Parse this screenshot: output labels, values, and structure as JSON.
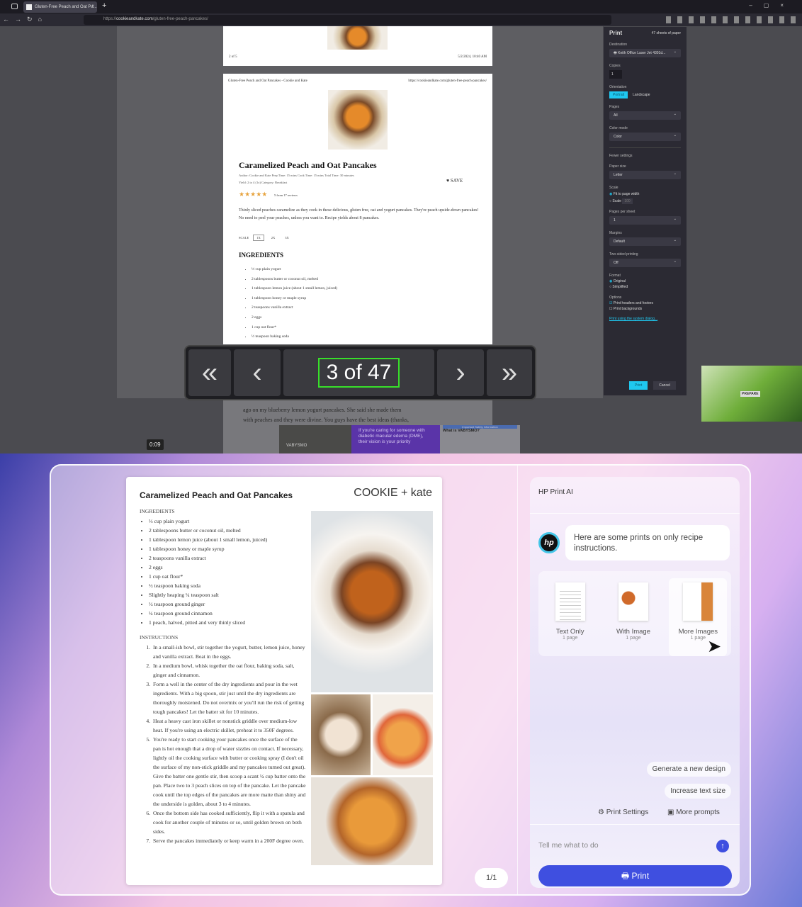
{
  "browser": {
    "tab_title": "Gluten-Free Peach and Oat Pa...",
    "url_scheme": "https://",
    "url_host": "cookieandkate.com",
    "url_path": "/gluten-free-peach-pancakes/"
  },
  "preview": {
    "page1_footer_left": "2 of 5",
    "page1_footer_right": "5/2/2024, 10:40 AM",
    "header_left": "Gluten-Free Peach and Oat Pancakes - Cookie and Kate",
    "header_right": "https://cookieandkate.com/gluten-free-peach-pancakes/",
    "title": "Caramelized Peach and Oat Pancakes",
    "meta1": "Author: Cookie and Kate   Prep Time: 15 mins   Cook Time: 15 mins   Total Time: 30 minutes",
    "meta2": "Yield: 2 to 4  (1x)   Category: Breakfast",
    "save": "SAVE",
    "stars": "★★★★★",
    "reviews": "5 from 17 reviews",
    "description": "Thinly sliced peaches caramelize as they cook in these delicious, gluten free, oat and yogurt pancakes. They're peach upside-down pancakes! No need to peel your peaches, unless you want to. Recipe yields about 8 pancakes.",
    "scale_label": "SCALE",
    "scale_options": [
      "1X",
      "2X",
      "3X"
    ],
    "ingredients_heading": "INGREDIENTS",
    "ingredients": [
      "⅓ cup plain yogurt",
      "2 tablespoons butter or coconut oil, melted",
      "1 tablespoon lemon juice (about 1 small lemon, juiced)",
      "1 tablespoon honey or maple syrup",
      "2 teaspoons vanilla extract",
      "2 eggs",
      "1 cup oat flour*",
      "½ teaspoon baking soda"
    ],
    "below_text": [
      "ago on my blueberry lemon yogurt pancakes. She said she made them",
      "with peaches and they were divine. You guys have the best ideas (thanks,"
    ],
    "ad_text": "If you're caring for someone with diabetic macular edema (DME), their vision is your priority",
    "ad_brand": "VABYSMO",
    "ad_side_title": "What is VABYSMO?",
    "ad_side_header": "Important Safety Information"
  },
  "print_panel": {
    "title": "Print",
    "sheets": "47 sheets of paper",
    "destination_label": "Destination",
    "destination": "Keith Office Laser Jet 4301d...",
    "copies_label": "Copies",
    "copies": "1",
    "orientation_label": "Orientation",
    "portrait": "Portrait",
    "landscape": "Landscape",
    "pages_label": "Pages",
    "pages": "All",
    "color_label": "Color mode",
    "color": "Color",
    "fewer": "Fewer settings",
    "paper_label": "Paper size",
    "paper": "Letter",
    "scale_label": "Scale",
    "fit": "Fit to page width",
    "scale": "Scale",
    "scale_value": "100",
    "pps_label": "Pages per sheet",
    "pps": "1",
    "margins_label": "Margins",
    "margins": "Default",
    "twosided_label": "Two-sided printing",
    "twosided": "Off",
    "format_label": "Format",
    "original": "Original",
    "simplified": "Simplified",
    "options_label": "Options",
    "headers": "Print headers and footers",
    "backgrounds": "Print backgrounds",
    "system_dialog": "Print using the system dialog...",
    "print": "Print",
    "cancel": "Cancel"
  },
  "page_nav": {
    "first": "«",
    "prev": "‹",
    "counter": "3 of 47",
    "next": "›",
    "last": "»"
  },
  "video_time": "0:09",
  "thumb_label": "PREPARE",
  "hp": {
    "recipe_title": "Caramelized Peach and Oat Pancakes",
    "logo": "COOKIE + kate",
    "ingredients_heading": "INGREDIENTS",
    "ingredients": [
      "⅓ cup plain yogurt",
      "2 tablespoons butter or coconut oil, melted",
      "1 tablespoon lemon juice (about 1 small lemon, juiced)",
      "1 tablespoon honey or maple syrup",
      "2 teaspoons vanilla extract",
      "2 eggs",
      "1 cup oat flour*",
      "½ teaspoon baking soda",
      "Slightly heaping ¼ teaspoon salt",
      "½ teaspoon ground ginger",
      "¼ teaspoon ground cinnamon",
      "1 peach, halved, pitted and very thinly sliced"
    ],
    "instructions_heading": "INSTRUCTIONS",
    "instructions": [
      "In a small-ish bowl, stir together the yogurt, butter, lemon juice, honey and vanilla extract. Beat in the eggs.",
      "In a medium bowl, whisk together the oat flour, baking soda, salt, ginger and cinnamon.",
      "Form a well in the center of the dry ingredients and pour in the wet ingredients. With a big spoon, stir just until the dry ingredients are thoroughly moistened. Do not overmix or you'll run the risk of getting tough pancakes! Let the batter sit for 10 minutes.",
      "Heat a heavy cast iron skillet or nonstick griddle over medium-low heat. If you're using an electric skillet, preheat it to 350F degrees.",
      "You're ready to start cooking your pancakes once the surface of the pan is hot enough that a drop of water sizzles on contact. If necessary, lightly oil the cooking surface with butter or cooking spray (I don't oil the surface of my non-stick griddle and my pancakes turned out great). Give the batter one gentle stir, then scoop a scant ¼ cup batter onto the pan. Place two to 3 peach slices on top of the pancake. Let the pancake cook until the top edges of the pancakes are more matte than shiny and the underside is golden, about 3 to 4 minutes.",
      "Once the bottom side has cooked sufficiently, flip it with a spatula and cook for another couple of minutes or so, until golden brown on both sides.",
      "Serve the pancakes immediately or keep warm in a 200F degree oven."
    ],
    "page_indicator": "1/1",
    "panel_title": "HP Print AI",
    "avatar": "hp",
    "message": "Here are some prints on only recipe instructions.",
    "options": [
      {
        "label": "Text Only",
        "pages": "1 page"
      },
      {
        "label": "With Image",
        "pages": "1 page"
      },
      {
        "label": "More Images",
        "pages": "1 page"
      }
    ],
    "chips": [
      "Generate a new design",
      "Increase text size"
    ],
    "print_settings": "Print Settings",
    "more_prompts": "More prompts",
    "input_placeholder": "Tell me what to do",
    "print_button": "Print",
    "accent": "#3f4fe0"
  }
}
